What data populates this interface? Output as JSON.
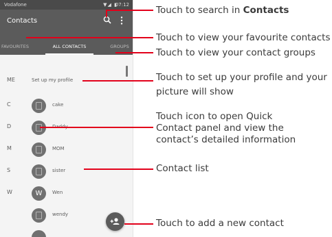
{
  "status_bar": {
    "carrier": "Vodafone",
    "icons": "▼◢ ▮",
    "time": "07:12"
  },
  "app_bar": {
    "title": "Contacts",
    "search_icon": "search-icon",
    "more_icon": "more-vertical-icon"
  },
  "tabs": [
    {
      "label": "FAVOURITES",
      "active": false
    },
    {
      "label": "ALL CONTACTS",
      "active": true
    },
    {
      "label": "GROUPS",
      "active": false
    }
  ],
  "me_row": {
    "letter": "ME",
    "label": "Set up my profile"
  },
  "contacts": [
    {
      "letter": "C",
      "avatar": "",
      "name": "cake"
    },
    {
      "letter": "D",
      "avatar": "",
      "name": "Daddy"
    },
    {
      "letter": "M",
      "avatar": "",
      "name": "MOM"
    },
    {
      "letter": "S",
      "avatar": "",
      "name": "sister"
    },
    {
      "letter": "W",
      "avatar": "W",
      "name": "Wen"
    },
    {
      "letter": "",
      "avatar": "",
      "name": "wendy"
    }
  ],
  "fab_icon": "add-contact-icon",
  "annotations": [
    {
      "prefix": "Touch to search in ",
      "bold": "Contacts"
    },
    {
      "text": "Touch to view your favourite contacts"
    },
    {
      "text": "Touch to view your contact groups"
    },
    {
      "line1": "Touch to set up your profile and your",
      "line2": "picture will show"
    },
    {
      "line1": "Touch icon to open Quick",
      "line2": "Contact panel and view the",
      "line3": "contact’s detailed information"
    },
    {
      "text": "Contact list"
    },
    {
      "text": "Touch to add a new contact"
    }
  ],
  "colors": {
    "callout_line": "#e2001a",
    "appbar": "#5b5b5b",
    "statusbar": "#4a4a4a"
  }
}
